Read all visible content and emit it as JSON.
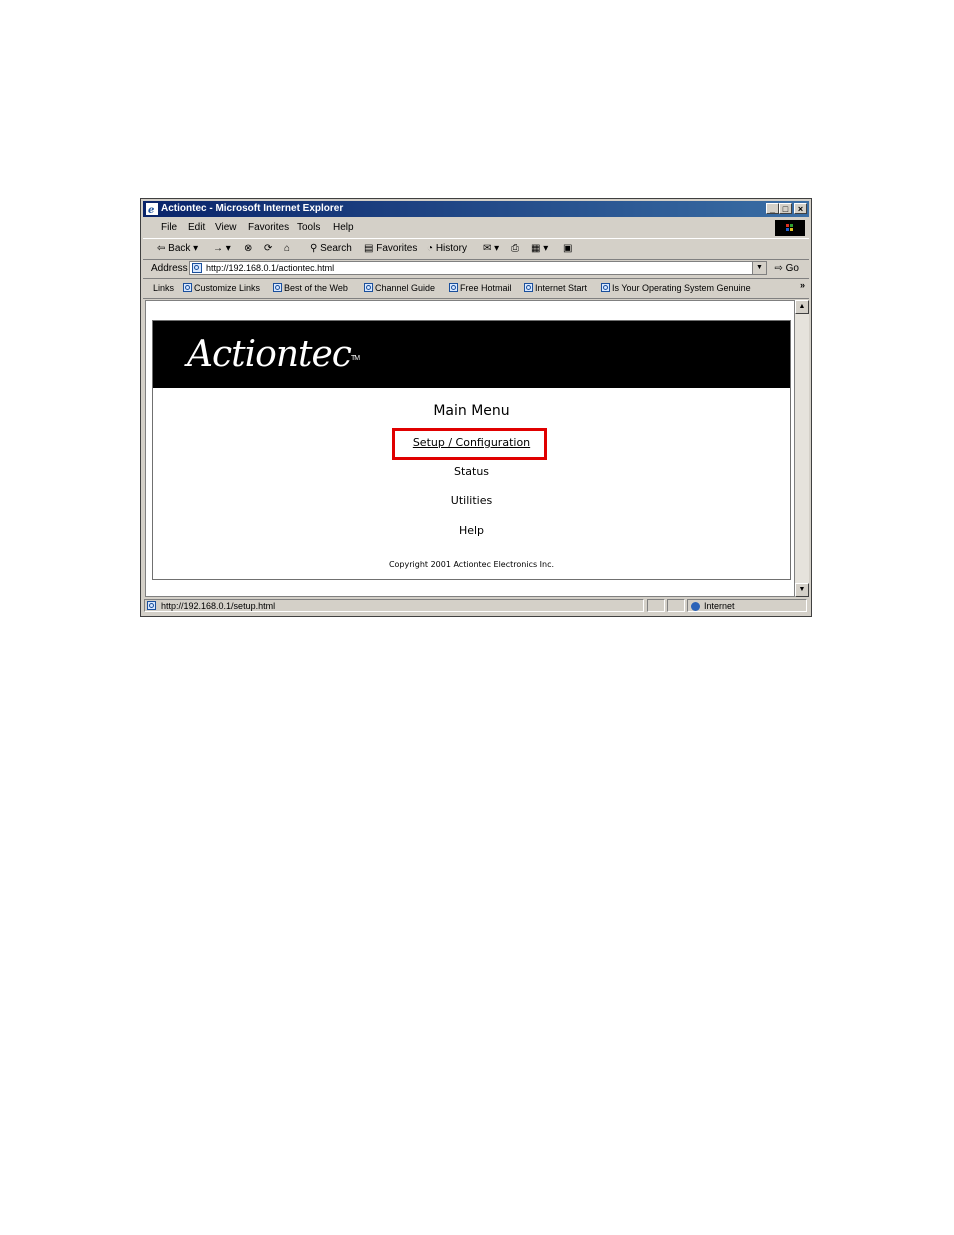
{
  "window": {
    "title": "Actiontec - Microsoft Internet Explorer",
    "controls": [
      "_",
      "□",
      "×"
    ]
  },
  "menubar": {
    "items": [
      "File",
      "Edit",
      "View",
      "Favorites",
      "Tools",
      "Help"
    ]
  },
  "toolbar": {
    "back": "Back",
    "forward": "→",
    "search": "Search",
    "favorites": "Favorites",
    "history": "History"
  },
  "address": {
    "label": "Address",
    "url": "http://192.168.0.1/actiontec.html",
    "go": "Go"
  },
  "links": {
    "label": "Links",
    "items": [
      "Customize Links",
      "Best of the Web",
      "Channel Guide",
      "Free Hotmail",
      "Internet Start",
      "Is Your Operating System Genuine"
    ],
    "more": "»"
  },
  "page": {
    "logo": "Actiontec",
    "logo_tm": "TM",
    "main_menu": "Main Menu",
    "menu": [
      "Setup / Configuration",
      "Status",
      "Utilities",
      "Help"
    ],
    "copyright": "Copyright 2001 Actiontec Electronics Inc."
  },
  "status": {
    "text": "http://192.168.0.1/setup.html",
    "zone": "Internet"
  },
  "colors": {
    "titlebar": "#0a246a",
    "highlight": "#e00000",
    "chrome": "#d4d0c8"
  }
}
